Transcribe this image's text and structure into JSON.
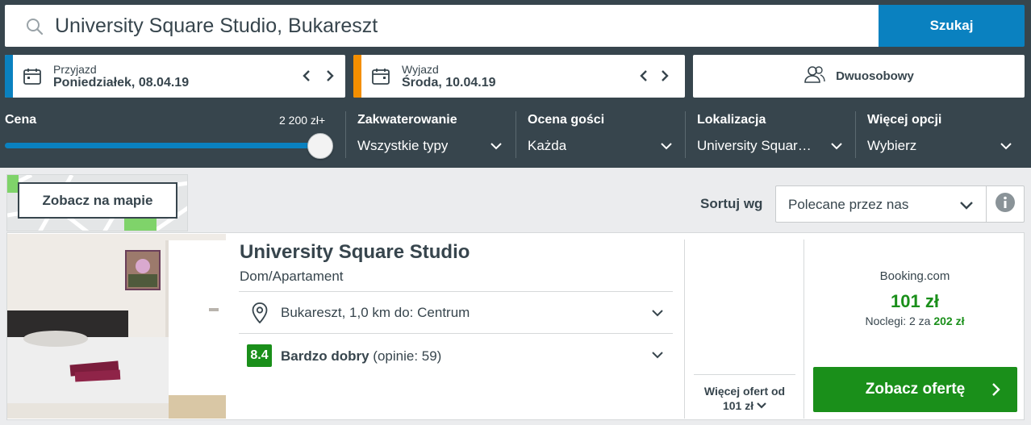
{
  "search": {
    "value": "University Square Studio, Bukareszt",
    "button_label": "Szukaj"
  },
  "dates": {
    "checkin_label": "Przyjazd",
    "checkin_value": "Poniedziałek, 08.04.19",
    "checkin_accent": "#0a81c0",
    "checkout_label": "Wyjazd",
    "checkout_value": "Środa, 10.04.19",
    "checkout_accent": "#f48f00"
  },
  "room": {
    "label": "Dwuosobowy"
  },
  "filters": {
    "price_label": "Cena",
    "price_value": "2 200 zł+",
    "accommodation_label": "Zakwaterowanie",
    "accommodation_value": "Wszystkie typy",
    "rating_label": "Ocena gości",
    "rating_value": "Każda",
    "location_label": "Lokalizacja",
    "location_value": "University Squar…",
    "more_label": "Więcej opcji",
    "more_value": "Wybierz"
  },
  "map": {
    "button_label": "Zobacz na mapie"
  },
  "sort": {
    "label": "Sortuj wg",
    "value": "Polecane przez nas"
  },
  "hotel": {
    "name": "University Square Studio",
    "type": "Dom/Apartament",
    "location": "Bukareszt, 1,0 km do: Centrum",
    "rating_score": "8.4",
    "rating_text": "Bardzo dobry",
    "rating_count": "(opinie: 59)"
  },
  "more_offers": {
    "line1": "Więcej ofert od",
    "line2": "101 zł"
  },
  "deal": {
    "provider": "Booking.com",
    "price": "101 zł",
    "nights_prefix": "Noclegi: 2 za",
    "nights_total": "202 zł",
    "button_label": "Zobacz ofertę"
  },
  "colors": {
    "header_bg": "#37454d",
    "brand_blue": "#0a81c0",
    "deal_green": "#1a8f1a",
    "checkout_orange": "#f48f00"
  }
}
